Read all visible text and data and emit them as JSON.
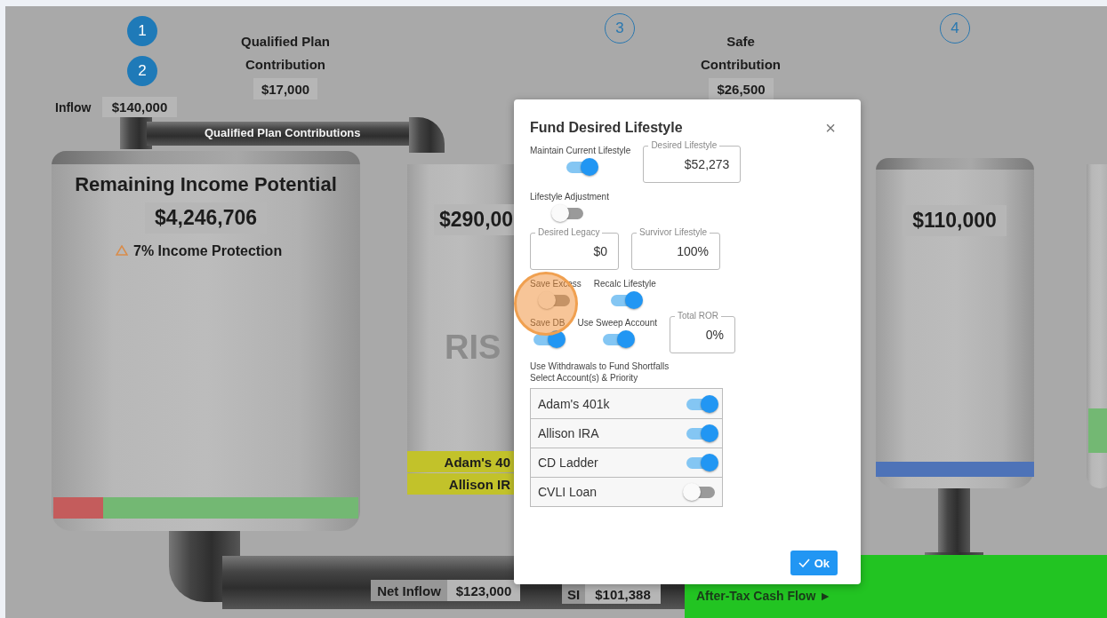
{
  "steps": [
    {
      "label": "1",
      "filled": true
    },
    {
      "label": "2",
      "filled": true
    },
    {
      "label": "3",
      "filled": false
    },
    {
      "label": "4",
      "filled": false
    }
  ],
  "diagram": {
    "qualified_plan": {
      "title": "Qualified Plan Contribution",
      "value": "$17,000"
    },
    "inflow": {
      "label": "Inflow",
      "value": "$140,000"
    },
    "pipe_label": "Qualified Plan Contributions",
    "remaining": {
      "title": "Remaining Income Potential",
      "value": "$4,246,706",
      "note": "7% Income Protection"
    },
    "tank_2": {
      "value": "$290,00",
      "watermark": "RIS",
      "accounts": [
        "Adam's 40",
        "Allison IR"
      ]
    },
    "safe": {
      "title": "Safe Contribution",
      "value": "$26,500"
    },
    "tank_4": {
      "value": "$110,000"
    },
    "net_inflow": {
      "label": "Net Inflow",
      "value": "$123,000"
    },
    "si": {
      "label": "SI",
      "value": "$101,388"
    },
    "cash_flow": "After-Tax Cash Flow ►"
  },
  "dialog": {
    "title": "Fund Desired Lifestyle",
    "close": "×",
    "rows": [
      {
        "items": [
          {
            "kind": "toggle",
            "label": "Maintain Current Lifestyle",
            "on": true
          },
          {
            "kind": "field",
            "label": "Desired Lifestyle",
            "value": "$52,273"
          }
        ]
      },
      {
        "items": [
          {
            "kind": "toggle",
            "label": "Lifestyle Adjustment",
            "on": false
          }
        ]
      },
      {
        "items": [
          {
            "kind": "field",
            "label": "Desired Legacy",
            "value": "$0"
          },
          {
            "kind": "field",
            "label": "Survivor Lifestyle",
            "value": "100%"
          }
        ]
      },
      {
        "items": [
          {
            "kind": "toggle",
            "label": "Save Excess",
            "on": false
          },
          {
            "kind": "toggle",
            "label": "Recalc Lifestyle",
            "on": true
          }
        ]
      },
      {
        "items": [
          {
            "kind": "toggle",
            "label": "Save DB",
            "on": true
          },
          {
            "kind": "toggle",
            "label": "Use Sweep Account",
            "on": true
          },
          {
            "kind": "field",
            "label": "Total ROR",
            "value": "0%"
          }
        ]
      }
    ],
    "notes": [
      "Use Withdrawals to Fund Shortfalls",
      "Select Account(s) & Priority"
    ],
    "accounts": [
      {
        "name": "Adam's 401k",
        "on": true
      },
      {
        "name": "Allison IRA",
        "on": true
      },
      {
        "name": "CD Ladder",
        "on": true
      },
      {
        "name": "CVLI Loan",
        "on": false
      }
    ],
    "ok": "Ok"
  }
}
